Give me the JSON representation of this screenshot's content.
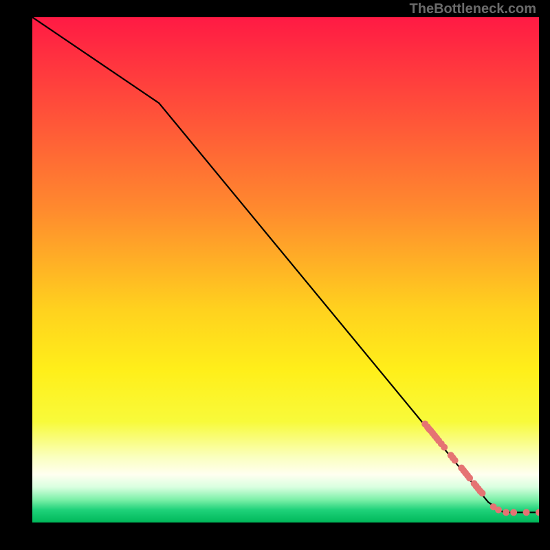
{
  "attribution": "TheBottleneck.com",
  "chart_data": {
    "type": "line",
    "title": "",
    "xlabel": "",
    "ylabel": "",
    "xlim": [
      0,
      100
    ],
    "ylim": [
      0,
      100
    ],
    "line": {
      "points": [
        {
          "x": 0,
          "y": 100
        },
        {
          "x": 25,
          "y": 83
        },
        {
          "x": 90,
          "y": 4
        },
        {
          "x": 93,
          "y": 2
        },
        {
          "x": 100,
          "y": 2
        }
      ],
      "color": "#000000"
    },
    "markers": {
      "color": "#e57373",
      "radius": 5,
      "points": [
        {
          "x": 77.5,
          "y": 19.5
        },
        {
          "x": 78.0,
          "y": 18.9
        },
        {
          "x": 78.3,
          "y": 18.5
        },
        {
          "x": 78.6,
          "y": 18.2
        },
        {
          "x": 79.0,
          "y": 17.7
        },
        {
          "x": 79.4,
          "y": 17.2
        },
        {
          "x": 79.8,
          "y": 16.7
        },
        {
          "x": 80.2,
          "y": 16.2
        },
        {
          "x": 80.7,
          "y": 15.6
        },
        {
          "x": 81.3,
          "y": 14.9
        },
        {
          "x": 82.6,
          "y": 13.3
        },
        {
          "x": 83.0,
          "y": 12.8
        },
        {
          "x": 83.4,
          "y": 12.3
        },
        {
          "x": 84.7,
          "y": 10.8
        },
        {
          "x": 85.1,
          "y": 10.3
        },
        {
          "x": 85.5,
          "y": 9.8
        },
        {
          "x": 85.9,
          "y": 9.3
        },
        {
          "x": 86.3,
          "y": 8.8
        },
        {
          "x": 87.2,
          "y": 7.7
        },
        {
          "x": 87.6,
          "y": 7.2
        },
        {
          "x": 88.0,
          "y": 6.7
        },
        {
          "x": 88.4,
          "y": 6.2
        },
        {
          "x": 88.8,
          "y": 5.8
        },
        {
          "x": 91.0,
          "y": 3.1
        },
        {
          "x": 92.0,
          "y": 2.5
        },
        {
          "x": 93.5,
          "y": 2.0
        },
        {
          "x": 95.0,
          "y": 2.0
        },
        {
          "x": 97.5,
          "y": 2.0
        },
        {
          "x": 100.0,
          "y": 2.0
        }
      ]
    },
    "background_gradient": {
      "stops": [
        {
          "offset": 0.0,
          "color": "#ff1a44"
        },
        {
          "offset": 0.18,
          "color": "#ff4e3a"
        },
        {
          "offset": 0.38,
          "color": "#ff8a2e"
        },
        {
          "offset": 0.58,
          "color": "#ffd21e"
        },
        {
          "offset": 0.7,
          "color": "#ffef1a"
        },
        {
          "offset": 0.8,
          "color": "#f8fa3a"
        },
        {
          "offset": 0.87,
          "color": "#faffbe"
        },
        {
          "offset": 0.905,
          "color": "#fffff0"
        },
        {
          "offset": 0.93,
          "color": "#d9ffe0"
        },
        {
          "offset": 0.955,
          "color": "#7cf0a8"
        },
        {
          "offset": 0.975,
          "color": "#1fd27a"
        },
        {
          "offset": 1.0,
          "color": "#00b85a"
        }
      ]
    }
  }
}
